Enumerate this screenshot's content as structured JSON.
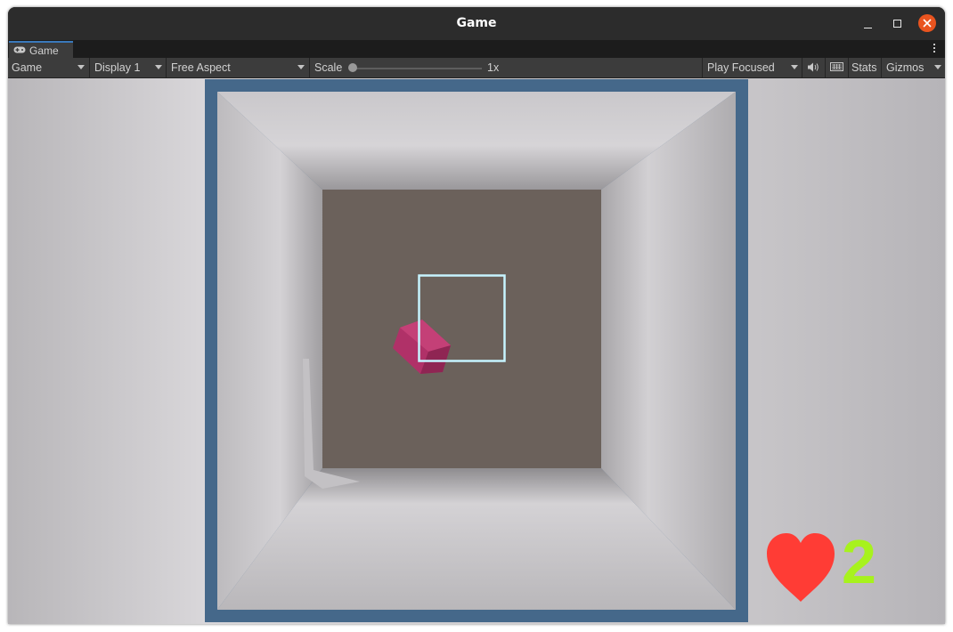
{
  "window": {
    "title": "Game"
  },
  "tab": {
    "label": "Game",
    "icon": "gamepad-icon"
  },
  "toolbar": {
    "view_mode": "Game",
    "display": "Display 1",
    "aspect": "Free Aspect",
    "scale_label": "Scale",
    "scale_value": "1x",
    "play_mode": "Play Focused",
    "stats": "Stats",
    "gizmos": "Gizmos"
  },
  "hud": {
    "lives": "2",
    "lives_icon": "heart-icon"
  },
  "colors": {
    "frame": "#45688a",
    "back_wall": "#6b615b",
    "cube": "#b03168",
    "target_outline": "#c6f4ff",
    "heart": "#ff3c35",
    "lives_text": "#a7f21d",
    "close_button": "#e9541f"
  }
}
